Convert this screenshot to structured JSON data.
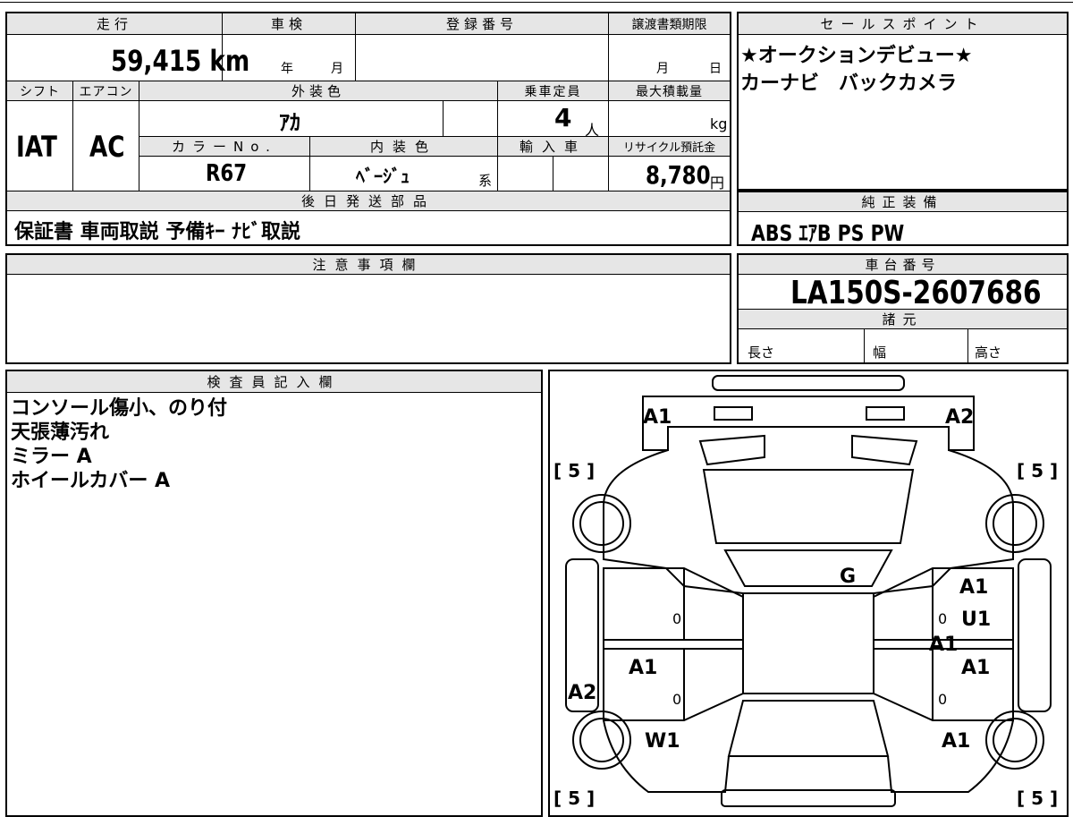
{
  "main_table": {
    "mileage": {
      "label": "走行",
      "value": "59,415 km"
    },
    "inspection": {
      "label": "車検",
      "year_unit": "年",
      "month_unit": "月"
    },
    "registration_number": {
      "label": "登録番号"
    },
    "transfer_deadline": {
      "label": "譲渡書類期限",
      "month_unit": "月",
      "day_unit": "日"
    },
    "shift": {
      "label": "シフト",
      "value": "IAT"
    },
    "aircon": {
      "label": "エアコン",
      "value": "AC"
    },
    "exterior_color": {
      "label": "外装色",
      "value": "ｱｶ"
    },
    "capacity": {
      "label": "乗車定員",
      "value": "4",
      "unit": "人"
    },
    "max_load": {
      "label": "最大積載量",
      "unit": "kg"
    },
    "color_no": {
      "label": "カラーNo.",
      "value": "R67"
    },
    "interior_color": {
      "label": "内装色",
      "value": "ﾍﾞｰｼﾞｭ",
      "suffix": "系"
    },
    "import": {
      "label": "輸入車"
    },
    "recycle_fee": {
      "label": "リサイクル預託金",
      "value": "8,780",
      "unit": "円"
    },
    "later_shipping": {
      "label": "後日発送部品",
      "value": "保証書 車両取説 予備ｷｰ ﾅﾋﾞ取説"
    }
  },
  "sales_points": {
    "label": "セールスポイント",
    "lines": [
      "★オークションデビュー★",
      "カーナビ　バックカメラ"
    ]
  },
  "standard_equipment": {
    "label": "純正装備",
    "value": "ABS ｴｱB PS PW"
  },
  "notes": {
    "label": "注意事項欄"
  },
  "chassis": {
    "label": "車台番号",
    "value": "LA150S-2607686"
  },
  "specs": {
    "label": "諸元",
    "length": "長さ",
    "width": "幅",
    "height": "高さ"
  },
  "inspector": {
    "label": "検査員記入欄",
    "lines": [
      "コンソール傷小、のり付",
      "天張薄汚れ",
      "ミラー A",
      "ホイールカバー A"
    ]
  },
  "diagram": {
    "marks": [
      "A1",
      "A2",
      "G",
      "A1",
      "U1",
      "A1",
      "A1",
      "A1",
      "A2",
      "W1",
      "A1"
    ],
    "tire_tread": [
      "[ 5 ]",
      "[ 5 ]",
      "[ 5 ]",
      "[ 5 ]"
    ],
    "zeros": [
      "0",
      "0",
      "0",
      "0"
    ]
  }
}
